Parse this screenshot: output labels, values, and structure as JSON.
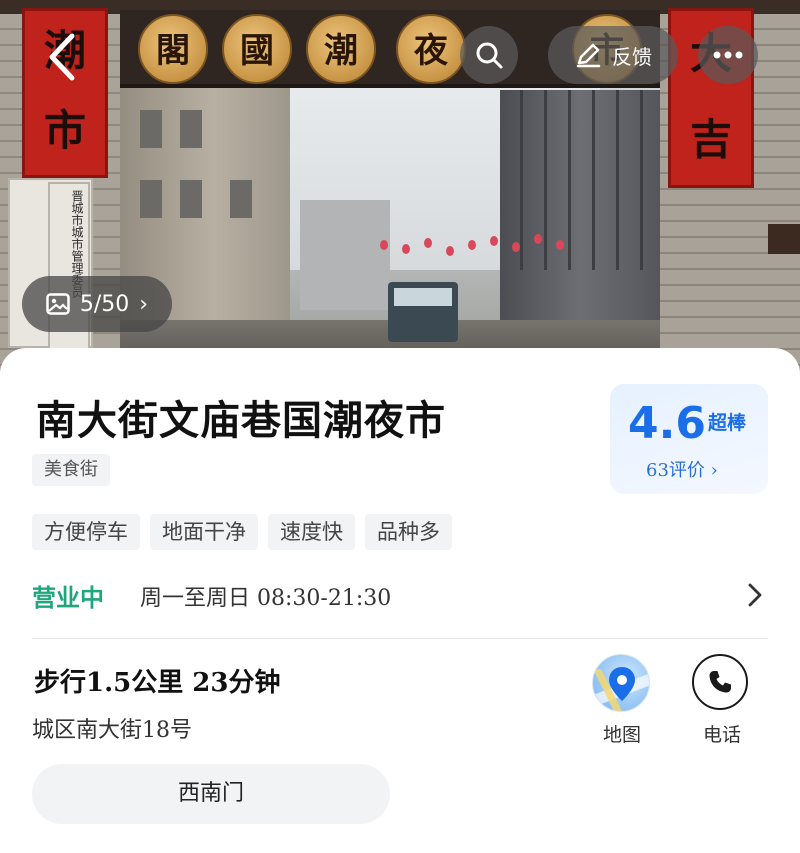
{
  "hero": {
    "photo_counter": "5/50",
    "gate_plaques": [
      "閣",
      "國",
      "潮",
      "夜",
      "市"
    ],
    "left_banner": "潮市",
    "right_banner": "大吉",
    "placard_text": "晋城市城",
    "placard_small_text": "晋城市城市管理委员"
  },
  "top_bar": {
    "back_icon": "chevron-left-icon",
    "search_icon": "search-icon",
    "feedback_label": "反馈",
    "feedback_icon": "edit-icon",
    "more_icon": "more-icon"
  },
  "poi": {
    "name": "南大街文庙巷国潮夜市",
    "category": "美食街",
    "rating": {
      "score": "4.6",
      "label": "超棒",
      "review_count": "63评价 ›"
    },
    "features": [
      "方便停车",
      "地面干净",
      "速度快",
      "品种多"
    ],
    "hours": {
      "status": "营业中",
      "text": "周一至周日 08:30-21:30"
    },
    "distance": "步行1.5公里  23分钟",
    "address": "城区南大街18号",
    "actions": {
      "map_label": "地图",
      "phone_label": "电话"
    },
    "entrance": "西南门"
  },
  "colors": {
    "accent_blue": "#1a6fe8",
    "open_green": "#1fa67a",
    "chip_bg": "#f2f3f5"
  }
}
